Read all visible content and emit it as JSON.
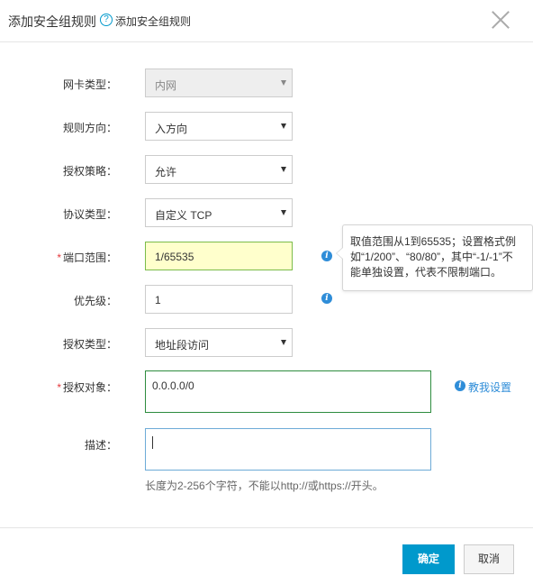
{
  "dialog": {
    "title": "添加安全组规则",
    "help_icon": "?",
    "help_link": "添加安全组规则",
    "close_icon": "close-icon"
  },
  "form": {
    "nic_type": {
      "label": "网卡类型：",
      "value": "内网"
    },
    "direction": {
      "label": "规则方向：",
      "value": "入方向"
    },
    "policy": {
      "label": "授权策略：",
      "value": "允许"
    },
    "protocol": {
      "label": "协议类型：",
      "value": "自定义 TCP"
    },
    "port_range": {
      "label": "端口范围：",
      "required": "*",
      "value": "1/65535"
    },
    "priority": {
      "label": "优先级：",
      "value": "1"
    },
    "auth_type": {
      "label": "授权类型：",
      "value": "地址段访问"
    },
    "auth_object": {
      "label": "授权对象：",
      "required": "*",
      "value": "0.0.0.0/0"
    },
    "description": {
      "label": "描述：",
      "value": "",
      "hint": "长度为2-256个字符，不能以http://或https://开头。"
    }
  },
  "tooltip": {
    "line1": "取值范围从1到65535；设置格式例",
    "line2": "如“1/200”、“80/80”，其中“-1/-1”不",
    "line3": "能单独设置，代表不限制端口。"
  },
  "guide_link": "教我设置",
  "info_glyph": "i",
  "buttons": {
    "ok": "确定",
    "cancel": "取消"
  },
  "colors": {
    "primary": "#0099cc",
    "info": "#2f8dd8",
    "required": "#e4393c",
    "active_field": "#ffffcc"
  }
}
